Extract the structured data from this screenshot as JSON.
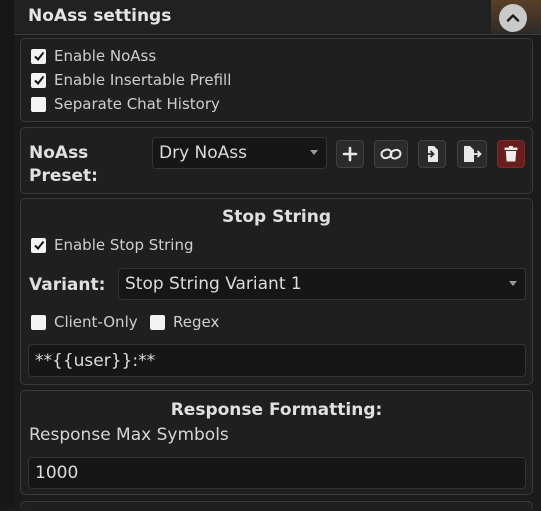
{
  "header": {
    "title": "NoAss settings"
  },
  "general": {
    "enable_noass": {
      "label": "Enable NoAss",
      "checked": true
    },
    "enable_insertable_prefill": {
      "label": "Enable Insertable Prefill",
      "checked": true
    },
    "separate_chat_history": {
      "label": "Separate Chat History",
      "checked": false
    }
  },
  "preset": {
    "label_line1": "NoAss",
    "label_line2": "Preset:",
    "selected": "Dry NoAss",
    "buttons": [
      "plus-icon",
      "link-icon",
      "import-icon",
      "export-icon",
      "trash-icon"
    ]
  },
  "stop_string": {
    "title": "Stop String",
    "enable_stop_string": {
      "label": "Enable Stop String",
      "checked": true
    },
    "variant_label": "Variant:",
    "variant_selected": "Stop String Variant 1",
    "client_only": {
      "label": "Client-Only",
      "checked": false
    },
    "regex": {
      "label": "Regex",
      "checked": false
    },
    "value": "**{{user}}:**"
  },
  "response_formatting": {
    "title": "Response Formatting:",
    "max_symbols_label": "Response Max Symbols",
    "max_symbols_value": "1000"
  },
  "colors": {
    "danger": "#6a1d1d",
    "checkbox": "#f3f3f3"
  }
}
